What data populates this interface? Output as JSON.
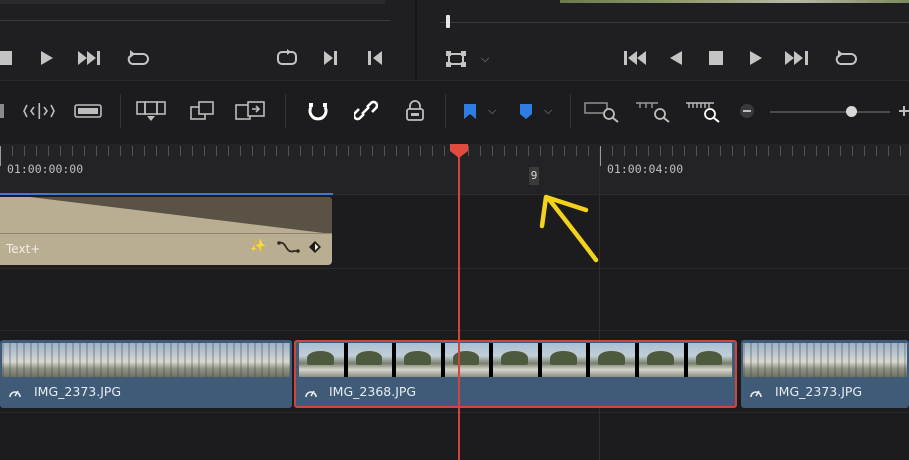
{
  "timeline": {
    "ruler": {
      "timecode_start": "01:00:00:00",
      "timecode_mid": "01:00:04:00",
      "marker_label": "9"
    },
    "title_track": {
      "clip_label": "Text+"
    },
    "video_track": {
      "clips": [
        {
          "label": "IMG_2373.JPG"
        },
        {
          "label": "IMG_2368.JPG"
        },
        {
          "label": "IMG_2373.JPG"
        }
      ]
    }
  },
  "colors": {
    "playhead": "#d0453d",
    "video_clip": "#3f5b77",
    "title_clip": "#b9ad92",
    "flag_marker": "#2f7de1",
    "annotation": "#f2d21b"
  },
  "icons": {
    "left_transport": [
      "stop-icon",
      "play-icon",
      "next-icon",
      "loop-icon"
    ],
    "right_transport": [
      "first-frame-icon",
      "reverse-play-icon",
      "stop-icon",
      "play-icon",
      "last-frame-icon",
      "loop-icon"
    ],
    "toolbar": [
      "blade-icon",
      "trim-icon",
      "dynamic-trim-icon",
      "insert-icon",
      "overwrite-icon",
      "replace-icon",
      "snapping-icon",
      "linked-selection-icon",
      "position-lock-icon",
      "flag-icon",
      "marker-icon",
      "zoom-full-icon",
      "zoom-detail-icon",
      "zoom-custom-icon",
      "zoom-out-icon",
      "zoom-in-icon"
    ]
  }
}
